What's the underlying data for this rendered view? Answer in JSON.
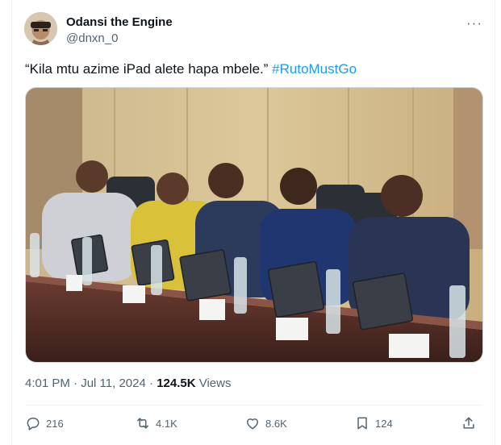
{
  "author": {
    "name": "Odansi the Engine",
    "handle": "@dnxn_0"
  },
  "tweet": {
    "text": "“Kila mtu azime iPad alete hapa mbele.” ",
    "hashtag": "#RutoMustGo"
  },
  "meta": {
    "time": "4:01 PM",
    "sep1": " · ",
    "date": "Jul 11, 2024",
    "sep2": " · ",
    "views_count": "124.5K",
    "views_label": " Views"
  },
  "actions": {
    "replies": "216",
    "reposts": "4.1K",
    "likes": "8.6K",
    "bookmarks": "124"
  },
  "icons": {
    "more": "more-icon",
    "reply": "reply-icon",
    "repost": "repost-icon",
    "like": "like-icon",
    "bookmark": "bookmark-icon",
    "share": "share-icon"
  },
  "colors": {
    "accent": "#1d9bf0",
    "muted": "#536471",
    "text": "#0f1419"
  }
}
